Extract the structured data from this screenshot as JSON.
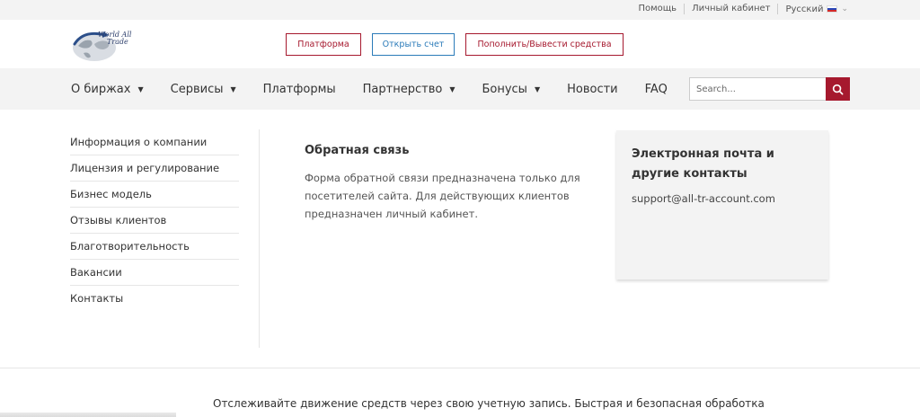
{
  "topbar": {
    "help": "Помощь",
    "cabinet": "Личный кабинет",
    "language": "Русский",
    "flag_icon": "ru-flag-icon"
  },
  "header": {
    "logo_text_line1": "World All",
    "logo_text_line2": "Trade",
    "buttons": {
      "platform": "Платформа",
      "open_account": "Открыть счет",
      "deposit": "Пополнить/Вывести средства"
    }
  },
  "nav": {
    "items": [
      {
        "label": "О биржах",
        "dropdown": true
      },
      {
        "label": "Сервисы",
        "dropdown": true
      },
      {
        "label": "Платформы",
        "dropdown": false
      },
      {
        "label": "Партнерство",
        "dropdown": true
      },
      {
        "label": "Бонусы",
        "dropdown": true
      },
      {
        "label": "Новости",
        "dropdown": false
      },
      {
        "label": "FAQ",
        "dropdown": false
      }
    ],
    "search_placeholder": "Search..."
  },
  "sidebar": {
    "items": [
      "Информация о компании",
      "Лицензия и регулирование",
      "Бизнес модель",
      "Отзывы клиентов",
      "Благотворительность",
      "Вакансии",
      "Контакты"
    ]
  },
  "feedback": {
    "title": "Обратная связь",
    "text": "Форма обратной связи предназначена только для посетителей сайта. Для действующих клиентов предназначен личный кабинет."
  },
  "contact": {
    "title": "Электронная почта и другие контакты",
    "email": "support@all-tr-account.com"
  },
  "footer": {
    "text": "Отслеживайте движение средств через свою учетную запись. Быстрая и безопасная обработка"
  },
  "colors": {
    "accent_red": "#a6192e",
    "accent_blue": "#2b7bb9",
    "bar_grey": "#f3f3f3"
  }
}
